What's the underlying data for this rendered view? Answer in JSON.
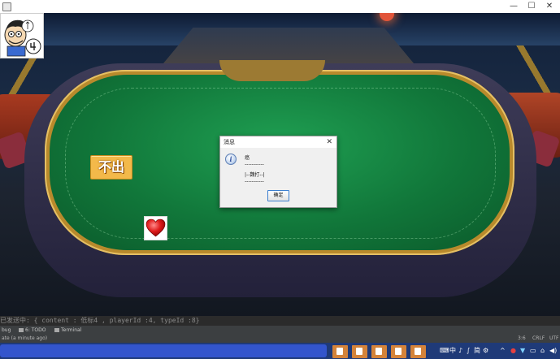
{
  "window": {
    "controls": {
      "minimize": "—",
      "maximize": "☐",
      "close": "✕"
    }
  },
  "game": {
    "pass_button_label": "不出",
    "card_suit": "heart",
    "colors": {
      "felt": "#138042",
      "pass_button": "#f3b94a",
      "heart": "#e01c1c"
    }
  },
  "dialog": {
    "title": "消息",
    "close": "✕",
    "icon": "i",
    "lines": [
      "癌",
      "-----------",
      "|--魏打--|",
      "-----------"
    ],
    "ok_label": "确定"
  },
  "ide": {
    "console_line": "已发送中: { content : 低标4 , playerId :4, typeId :8}",
    "tabs": [
      {
        "label": "bug"
      },
      {
        "label": "6: TODO"
      },
      {
        "label": "Terminal"
      }
    ],
    "status_left": "ate (a minute ago)",
    "position": "3:6",
    "line_ending": "CRLF",
    "encoding": "UTF"
  },
  "taskbar": {
    "app_count": 5,
    "tray": [
      "⌨",
      "中",
      "♪",
      "∫",
      "简",
      "⚙",
      "^",
      "●",
      "▼",
      "▭",
      "⌂",
      "◀)"
    ]
  }
}
